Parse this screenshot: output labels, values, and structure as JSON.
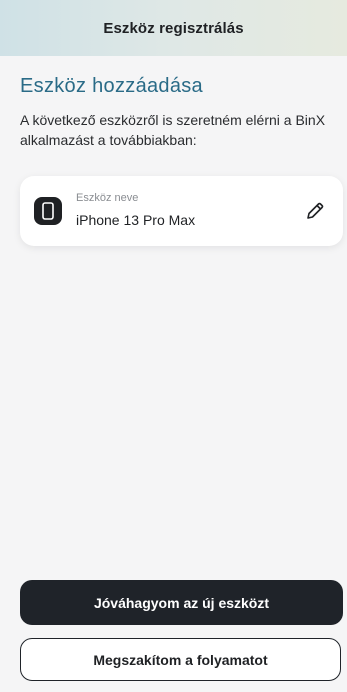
{
  "header": {
    "title": "Eszköz regisztrálás"
  },
  "main": {
    "title": "Eszköz hozzáadása",
    "description": "A következő eszközről is szeretném elérni a BinX alkalmazást a továbbiakban:",
    "device": {
      "label": "Eszköz neve",
      "value": "iPhone 13 Pro Max",
      "icon": "phone-icon",
      "edit_icon": "pencil-icon"
    }
  },
  "actions": {
    "confirm_label": "Jóváhagyom az új eszközt",
    "cancel_label": "Megszakítom a folyamatot"
  },
  "colors": {
    "accent_title": "#2a6b87",
    "primary_button": "#1f2329",
    "header_gradient_start": "#cfe1e6",
    "header_gradient_end": "#e6eadf"
  }
}
